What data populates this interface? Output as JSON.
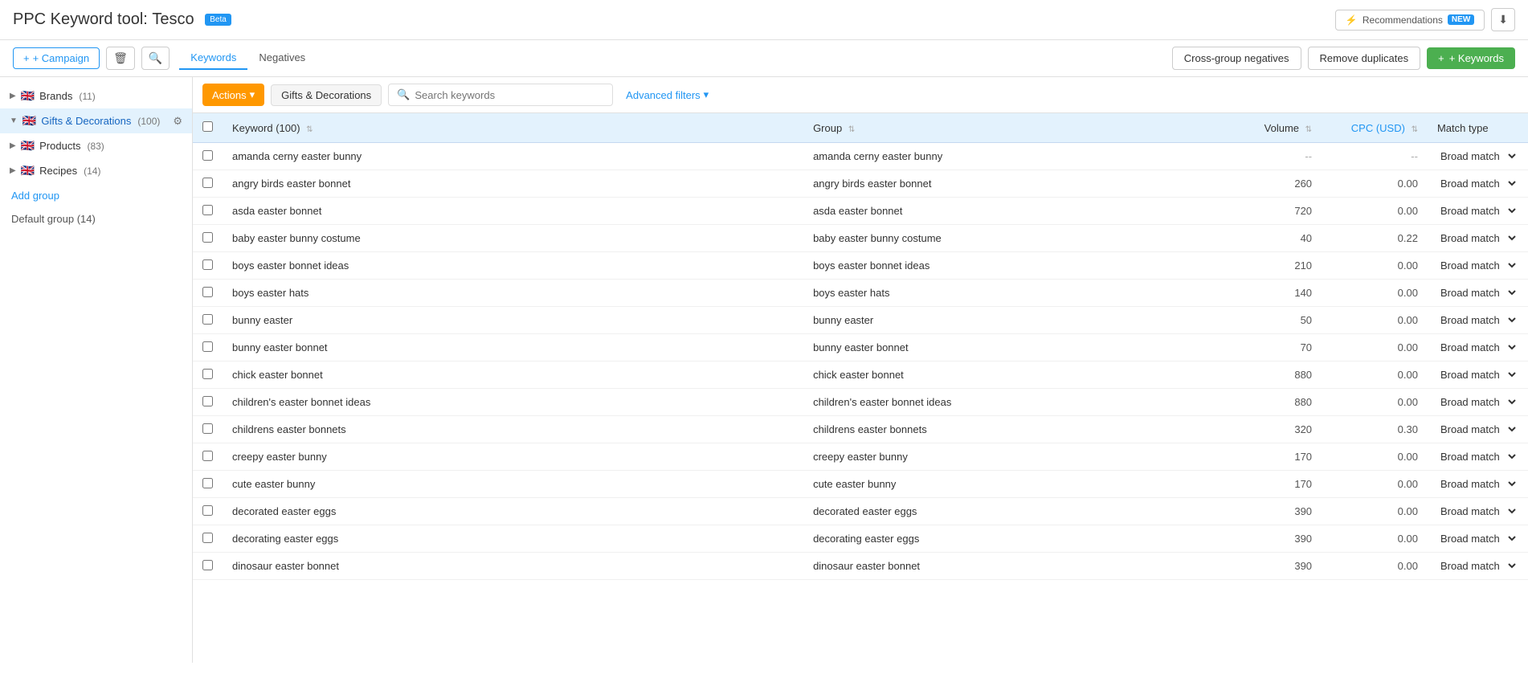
{
  "header": {
    "title_prefix": "PPC Keyword tool:",
    "title_name": "Tesco",
    "beta_label": "Beta",
    "recommendations_label": "Recommendations",
    "recommendations_badge": "NEW",
    "download_icon": "⬇"
  },
  "toolbar": {
    "campaign_btn": "+ Campaign",
    "delete_icon": "🗑",
    "search_icon": "🔍",
    "tabs": [
      {
        "label": "Keywords",
        "active": true
      },
      {
        "label": "Negatives",
        "active": false
      }
    ],
    "cross_group_btn": "Cross-group negatives",
    "remove_dupes_btn": "Remove duplicates",
    "add_keywords_btn": "+ Keywords"
  },
  "sidebar": {
    "groups": [
      {
        "id": "brands",
        "label": "Brands",
        "count": 11,
        "active": false,
        "expanded": false
      },
      {
        "id": "gifts-decorations",
        "label": "Gifts & Decorations",
        "count": 100,
        "active": true,
        "expanded": true
      },
      {
        "id": "products",
        "label": "Products",
        "count": 83,
        "active": false,
        "expanded": false
      },
      {
        "id": "recipes",
        "label": "Recipes",
        "count": 14,
        "active": false,
        "expanded": false
      }
    ],
    "add_group_label": "Add group",
    "default_group_label": "Default group",
    "default_group_count": 14
  },
  "filter_bar": {
    "actions_btn": "Actions",
    "actions_dropdown_icon": "▾",
    "group_tag": "Gifts & Decorations",
    "search_placeholder": "Search keywords",
    "advanced_filters_label": "Advanced filters",
    "advanced_filters_icon": "▾"
  },
  "table": {
    "columns": [
      {
        "id": "keyword",
        "label": "Keyword",
        "count": 100
      },
      {
        "id": "group",
        "label": "Group"
      },
      {
        "id": "volume",
        "label": "Volume"
      },
      {
        "id": "cpc",
        "label": "CPC (USD)"
      },
      {
        "id": "match_type",
        "label": "Match type"
      }
    ],
    "rows": [
      {
        "keyword": "amanda cerny easter bunny",
        "group": "amanda cerny easter bunny",
        "volume": "--",
        "cpc": "--",
        "match_type": "Broad match"
      },
      {
        "keyword": "angry birds easter bonnet",
        "group": "angry birds easter bonnet",
        "volume": "260",
        "cpc": "0.00",
        "match_type": "Broad match"
      },
      {
        "keyword": "asda easter bonnet",
        "group": "asda easter bonnet",
        "volume": "720",
        "cpc": "0.00",
        "match_type": "Broad match"
      },
      {
        "keyword": "baby easter bunny costume",
        "group": "baby easter bunny costume",
        "volume": "40",
        "cpc": "0.22",
        "match_type": "Broad match"
      },
      {
        "keyword": "boys easter bonnet ideas",
        "group": "boys easter bonnet ideas",
        "volume": "210",
        "cpc": "0.00",
        "match_type": "Broad match"
      },
      {
        "keyword": "boys easter hats",
        "group": "boys easter hats",
        "volume": "140",
        "cpc": "0.00",
        "match_type": "Broad match"
      },
      {
        "keyword": "bunny easter",
        "group": "bunny easter",
        "volume": "50",
        "cpc": "0.00",
        "match_type": "Broad match"
      },
      {
        "keyword": "bunny easter bonnet",
        "group": "bunny easter bonnet",
        "volume": "70",
        "cpc": "0.00",
        "match_type": "Broad match"
      },
      {
        "keyword": "chick easter bonnet",
        "group": "chick easter bonnet",
        "volume": "880",
        "cpc": "0.00",
        "match_type": "Broad match"
      },
      {
        "keyword": "children's easter bonnet ideas",
        "group": "children's easter bonnet ideas",
        "volume": "880",
        "cpc": "0.00",
        "match_type": "Broad match"
      },
      {
        "keyword": "childrens easter bonnets",
        "group": "childrens easter bonnets",
        "volume": "320",
        "cpc": "0.30",
        "match_type": "Broad match"
      },
      {
        "keyword": "creepy easter bunny",
        "group": "creepy easter bunny",
        "volume": "170",
        "cpc": "0.00",
        "match_type": "Broad match"
      },
      {
        "keyword": "cute easter bunny",
        "group": "cute easter bunny",
        "volume": "170",
        "cpc": "0.00",
        "match_type": "Broad match"
      },
      {
        "keyword": "decorated easter eggs",
        "group": "decorated easter eggs",
        "volume": "390",
        "cpc": "0.00",
        "match_type": "Broad match"
      },
      {
        "keyword": "decorating easter eggs",
        "group": "decorating easter eggs",
        "volume": "390",
        "cpc": "0.00",
        "match_type": "Broad match"
      },
      {
        "keyword": "dinosaur easter bonnet",
        "group": "dinosaur easter bonnet",
        "volume": "390",
        "cpc": "0.00",
        "match_type": "Broad match"
      }
    ]
  }
}
